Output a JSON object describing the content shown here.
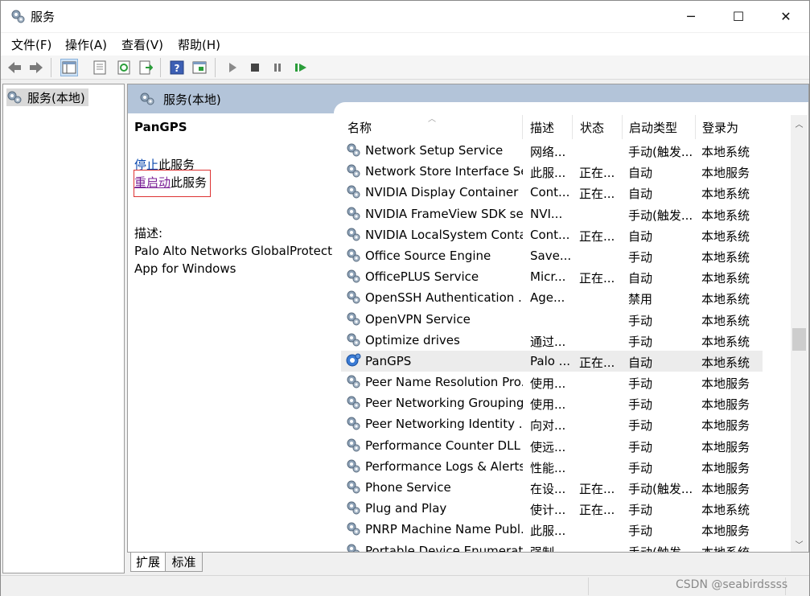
{
  "window": {
    "title": "服务",
    "minimize_glyph": "─",
    "maximize_glyph": "☐",
    "close_glyph": "✕"
  },
  "menu": [
    {
      "label": "文件(F)"
    },
    {
      "label": "操作(A)"
    },
    {
      "label": "查看(V)"
    },
    {
      "label": "帮助(H)"
    }
  ],
  "toolbar": {
    "icons": [
      "back-arrow-icon",
      "forward-arrow-icon",
      "console-tree-icon",
      "properties-icon",
      "refresh-icon",
      "export-list-icon",
      "help-icon",
      "view-icon",
      "start-service-icon",
      "stop-service-icon",
      "pause-service-icon",
      "restart-service-icon"
    ]
  },
  "tree": {
    "root_label": "服务(本地)"
  },
  "main": {
    "header_label": "服务(本地)",
    "selected_service": "PanGPS",
    "stop_link": "停止",
    "stop_suffix": "此服务",
    "restart_link": "重启动",
    "restart_suffix": "此服务",
    "desc_label": "描述:",
    "desc_text": "Palo Alto Networks GlobalProtect App for Windows"
  },
  "columns": {
    "name": "名称",
    "desc": "描述",
    "status": "状态",
    "startup": "启动类型",
    "logon": "登录为"
  },
  "services": [
    {
      "name": "Network Setup Service",
      "desc": "网络...",
      "status": "",
      "startup": "手动(触发...",
      "logon": "本地系统"
    },
    {
      "name": "Network Store Interface Se...",
      "desc": "此服...",
      "status": "正在...",
      "startup": "自动",
      "logon": "本地服务"
    },
    {
      "name": "NVIDIA Display Container LS",
      "desc": "Cont...",
      "status": "正在...",
      "startup": "自动",
      "logon": "本地系统"
    },
    {
      "name": "NVIDIA FrameView SDK se...",
      "desc": "NVI...",
      "status": "",
      "startup": "手动(触发...",
      "logon": "本地系统"
    },
    {
      "name": "NVIDIA LocalSystem Conta...",
      "desc": "Cont...",
      "status": "正在...",
      "startup": "自动",
      "logon": "本地系统"
    },
    {
      "name": "Office  Source Engine",
      "desc": "Save...",
      "status": "",
      "startup": "手动",
      "logon": "本地系统"
    },
    {
      "name": "OfficePLUS Service",
      "desc": "Micr...",
      "status": "正在...",
      "startup": "自动",
      "logon": "本地系统"
    },
    {
      "name": "OpenSSH Authentication ...",
      "desc": "Age...",
      "status": "",
      "startup": "禁用",
      "logon": "本地系统"
    },
    {
      "name": "OpenVPN Service",
      "desc": "",
      "status": "",
      "startup": "手动",
      "logon": "本地系统"
    },
    {
      "name": "Optimize drives",
      "desc": "通过...",
      "status": "",
      "startup": "手动",
      "logon": "本地系统"
    },
    {
      "name": "PanGPS",
      "desc": "Palo ...",
      "status": "正在...",
      "startup": "自动",
      "logon": "本地系统",
      "selected": true
    },
    {
      "name": "Peer Name Resolution Pro...",
      "desc": "使用...",
      "status": "",
      "startup": "手动",
      "logon": "本地服务"
    },
    {
      "name": "Peer Networking Grouping",
      "desc": "使用...",
      "status": "",
      "startup": "手动",
      "logon": "本地服务"
    },
    {
      "name": "Peer Networking Identity ...",
      "desc": "向对...",
      "status": "",
      "startup": "手动",
      "logon": "本地服务"
    },
    {
      "name": "Performance Counter DLL ...",
      "desc": "使远...",
      "status": "",
      "startup": "手动",
      "logon": "本地服务"
    },
    {
      "name": "Performance Logs & Alerts",
      "desc": "性能...",
      "status": "",
      "startup": "手动",
      "logon": "本地服务"
    },
    {
      "name": "Phone Service",
      "desc": "在设...",
      "status": "正在...",
      "startup": "手动(触发...",
      "logon": "本地服务"
    },
    {
      "name": "Plug and Play",
      "desc": "使计...",
      "status": "正在...",
      "startup": "手动",
      "logon": "本地系统"
    },
    {
      "name": "PNRP Machine Name Publ...",
      "desc": "此服...",
      "status": "",
      "startup": "手动",
      "logon": "本地服务"
    },
    {
      "name": "Portable Device Enumerat...",
      "desc": "强制...",
      "status": "",
      "startup": "手动(触发...",
      "logon": "本地系统"
    }
  ],
  "tabs": [
    {
      "label": "扩展",
      "active": true
    },
    {
      "label": "标准",
      "active": false
    }
  ],
  "statusbar": {
    "watermark": "CSDN @seabirdssss"
  },
  "colors": {
    "header_blue": "#b3c4d9",
    "link_blue": "#0645ad",
    "link_visited": "#7a1f96",
    "highlight_box": "#dd3333"
  }
}
